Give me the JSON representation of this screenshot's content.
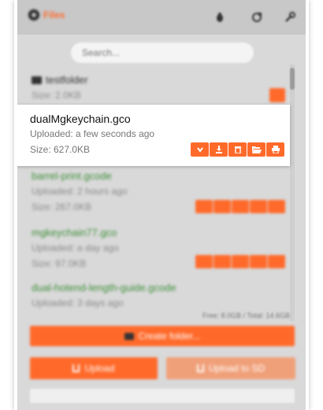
{
  "header": {
    "brand_name": "Files",
    "icons": [
      "octoprint-icon",
      "bug-icon",
      "refresh-icon",
      "wrench-icon"
    ]
  },
  "search": {
    "placeholder": "Search..."
  },
  "folder": {
    "name": "testfolder",
    "size": "Size: 2.0KB"
  },
  "selected_file": {
    "name": "dualMgkeychain.gco",
    "uploaded": "Uploaded: a few seconds ago",
    "size": "Size: 627.0KB",
    "actions": [
      "chevron-down-icon",
      "download-icon",
      "trash-icon",
      "folder-open-icon",
      "print-icon"
    ]
  },
  "files": [
    {
      "name": "barrel-print.gcode",
      "uploaded": "Uploaded: 2 hours ago",
      "size": "Size: 267.0KB"
    },
    {
      "name": "mgkeychain77.gco",
      "uploaded": "Uploaded: a day ago",
      "size": "Size: 97.0KB"
    },
    {
      "name": "dual-hotend-length-guide.gcode",
      "uploaded": "Uploaded: 3 days ago",
      "size": ""
    }
  ],
  "storage": "Free: 8.0GB / Total: 14.6GB",
  "buttons": {
    "create_folder": "Create folder...",
    "upload": "Upload",
    "upload_sd": "Upload to SD"
  },
  "colors": {
    "accent": "#ff6a2b",
    "accent_light": "#f0a079",
    "file_link": "#3f8f3a"
  }
}
